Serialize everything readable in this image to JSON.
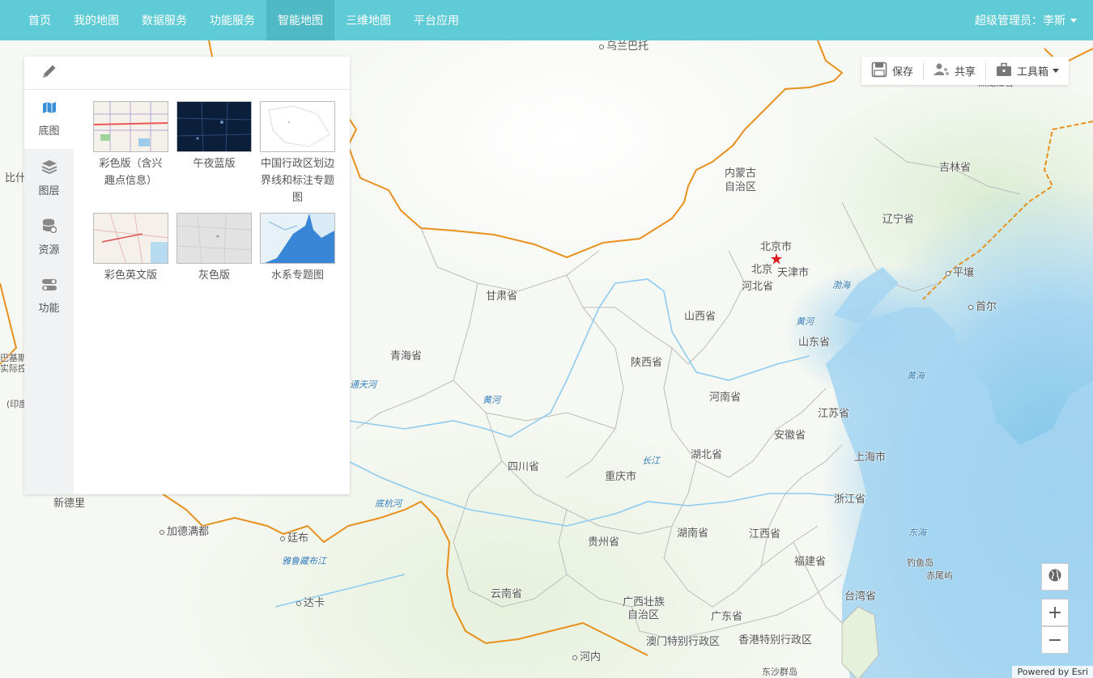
{
  "nav": {
    "items": [
      {
        "label": "首页"
      },
      {
        "label": "我的地图"
      },
      {
        "label": "数据服务"
      },
      {
        "label": "功能服务"
      },
      {
        "label": "智能地图"
      },
      {
        "label": "三维地图"
      },
      {
        "label": "平台应用"
      }
    ],
    "active_index": 4,
    "user_label": "超级管理员：李斯"
  },
  "panel": {
    "header_icon": "pencil-icon",
    "side": [
      {
        "label": "底图",
        "icon": "map-icon"
      },
      {
        "label": "图层",
        "icon": "layers-icon"
      },
      {
        "label": "资源",
        "icon": "database-icon"
      },
      {
        "label": "功能",
        "icon": "toggle-icon"
      }
    ],
    "basemaps": [
      {
        "label": "彩色版（含兴趣点信息）"
      },
      {
        "label": "午夜蓝版"
      },
      {
        "label": "中国行政区划边界线和标注专题图"
      },
      {
        "label": "彩色英文版"
      },
      {
        "label": "灰色版"
      },
      {
        "label": "水系专题图"
      }
    ]
  },
  "toolbar": {
    "save_label": "保存",
    "share_label": "共享",
    "toolbox_label": "工具箱"
  },
  "map": {
    "labels": [
      "乌兰巴托",
      "内蒙古",
      "自治区",
      "吉林省",
      "辽宁省",
      "北京市",
      "北京",
      "天津市",
      "河北省",
      "甘肃省",
      "山西省",
      "平壤",
      "首尔",
      "渤海",
      "青海省",
      "陕西省",
      "山东省",
      "黄河",
      "黄河",
      "黄海",
      "河南省",
      "江苏省",
      "安徽省",
      "通天河",
      "湖北省",
      "上海市",
      "四川省",
      "长江",
      "重庆市",
      "浙江省",
      "新德里",
      "雅鲁藏布江",
      "加德满都",
      "廷布",
      "贵州省",
      "湖南省",
      "江西省",
      "东海",
      "福建省",
      "钓鱼岛",
      "赤尾屿",
      "达卡",
      "云南省",
      "广西壮族",
      "自治区",
      "广东省",
      "台湾省",
      "澳门特别行政区",
      "香港特别行政区",
      "河内",
      "东沙群岛",
      "比什",
      "黑龙江省",
      "巴基斯",
      "实际控",
      "(印度",
      "底杭河"
    ],
    "attribution": "Powered by Esri",
    "colors": {
      "border": "#e8901e",
      "water": "#8fcbef",
      "province": "#b9b9b9"
    }
  },
  "controls": {
    "globe_icon": "globe-icon",
    "zoom_in": "+",
    "zoom_out": "−"
  }
}
